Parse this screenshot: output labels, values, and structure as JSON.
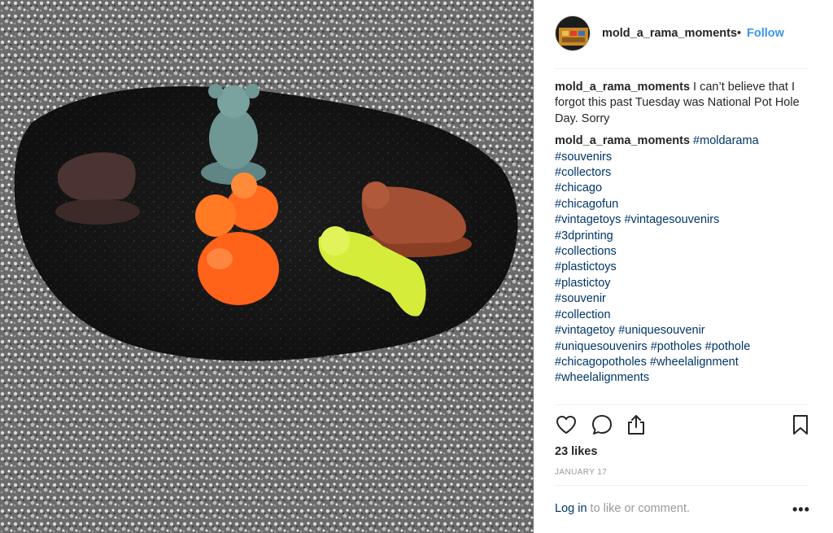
{
  "header": {
    "username": "mold_a_rama_moments",
    "separator": "•",
    "follow_label": "Follow",
    "avatar_icon": "profile-avatar"
  },
  "caption": {
    "username": "mold_a_rama_moments",
    "text": "I can’t believe that I forgot this past Tuesday was National Pot Hole Day. Sorry"
  },
  "hashtag_comment": {
    "username": "mold_a_rama_moments",
    "lines": [
      [
        "#moldarama"
      ],
      [
        "#souvenirs"
      ],
      [
        "#collectors"
      ],
      [
        "#chicago"
      ],
      [
        "#chicagofun"
      ],
      [
        "#vintagetoys",
        "#vintagesouvenirs"
      ],
      [
        "#3dprinting"
      ],
      [
        "#collections"
      ],
      [
        "#plastictoys"
      ],
      [
        "#plastictoy"
      ],
      [
        "#souvenir"
      ],
      [
        "#collection"
      ],
      [
        "#vintagetoy",
        "#uniquesouvenir"
      ],
      [
        "#uniquesouvenirs",
        "#potholes",
        "#pothole"
      ],
      [
        "#chicagopotholes",
        "#wheelalignment"
      ],
      [
        "#wheelalignments"
      ]
    ]
  },
  "actions": {
    "icons": [
      "heart-icon",
      "comment-icon",
      "share-icon",
      "bookmark-icon"
    ]
  },
  "likes": "23 likes",
  "date": "JANUARY 17",
  "footer": {
    "login_label": "Log in",
    "login_suffix": " to like or comment.",
    "more_label": "•••"
  },
  "colors": {
    "link": "#003569",
    "follow": "#3897f0",
    "muted": "#999999"
  }
}
